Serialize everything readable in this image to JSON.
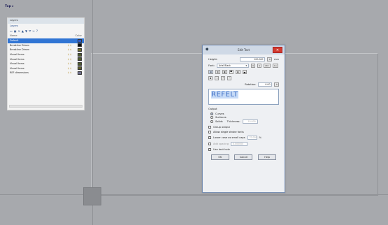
{
  "viewport": {
    "label": "Top ▸"
  },
  "layers_panel": {
    "title": "Layers",
    "subtitle": "Layers",
    "toolbar_icons": [
      "new-layer-icon",
      "new-sublayer-icon",
      "delete-icon",
      "move-up-icon",
      "move-down-icon",
      "filter-icon",
      "tools-icon",
      "help-icon"
    ],
    "columns": {
      "name": "Name",
      "color": "Color"
    },
    "rows": [
      {
        "name": "Default",
        "selected": true,
        "color": "#2b56c6"
      },
      {
        "name": "Breakline Dimen",
        "selected": false,
        "color": "#0f0f0f"
      },
      {
        "name": "Breakline Dimen",
        "selected": false,
        "color": "#6f6f2a"
      },
      {
        "name": "Visual Items",
        "selected": false,
        "color": "#4e5a2c"
      },
      {
        "name": "Visual Items",
        "selected": false,
        "color": "#4e5a2c"
      },
      {
        "name": "Visual Items",
        "selected": false,
        "color": "#4e5a2c"
      },
      {
        "name": "Visual Items",
        "selected": false,
        "color": "#5d5d2a"
      },
      {
        "name": "REF dimensions",
        "selected": false,
        "color": "#6c6c8a"
      }
    ]
  },
  "dialog": {
    "title": "Edit Text",
    "height_label": "Height:",
    "height_value": "100.000",
    "height_unit": "mm",
    "font_label": "Font:",
    "font_value": "Arial Black",
    "font_btns": [
      "A",
      "a",
      "Abc",
      "A+"
    ],
    "style_btns": [
      "B",
      "I",
      "⁰",
      "ˣ"
    ],
    "rotation_label": "Rotation:",
    "rotation_value": "0.00",
    "text_value": "REFELT",
    "output_label": "Output",
    "options": {
      "curves": "Curves",
      "surfaces": "Surfaces",
      "solids": "Solids"
    },
    "thickness_label": "Thickness:",
    "thickness_value": "10.000",
    "group_output": "Group output",
    "allow_single": "Allow single stroke fonts",
    "lower_case": "Lower case as small caps",
    "lower_case_value": "70.000",
    "percent": "%",
    "add_spacing": "Add spacing",
    "add_spacing_value": "0.000000",
    "use_text_hole": "Use text hole",
    "buttons": {
      "ok": "OK",
      "cancel": "Cancel",
      "help": "Help"
    }
  },
  "colors": {
    "background": "#a7a9ad",
    "accent": "#3175d4"
  }
}
